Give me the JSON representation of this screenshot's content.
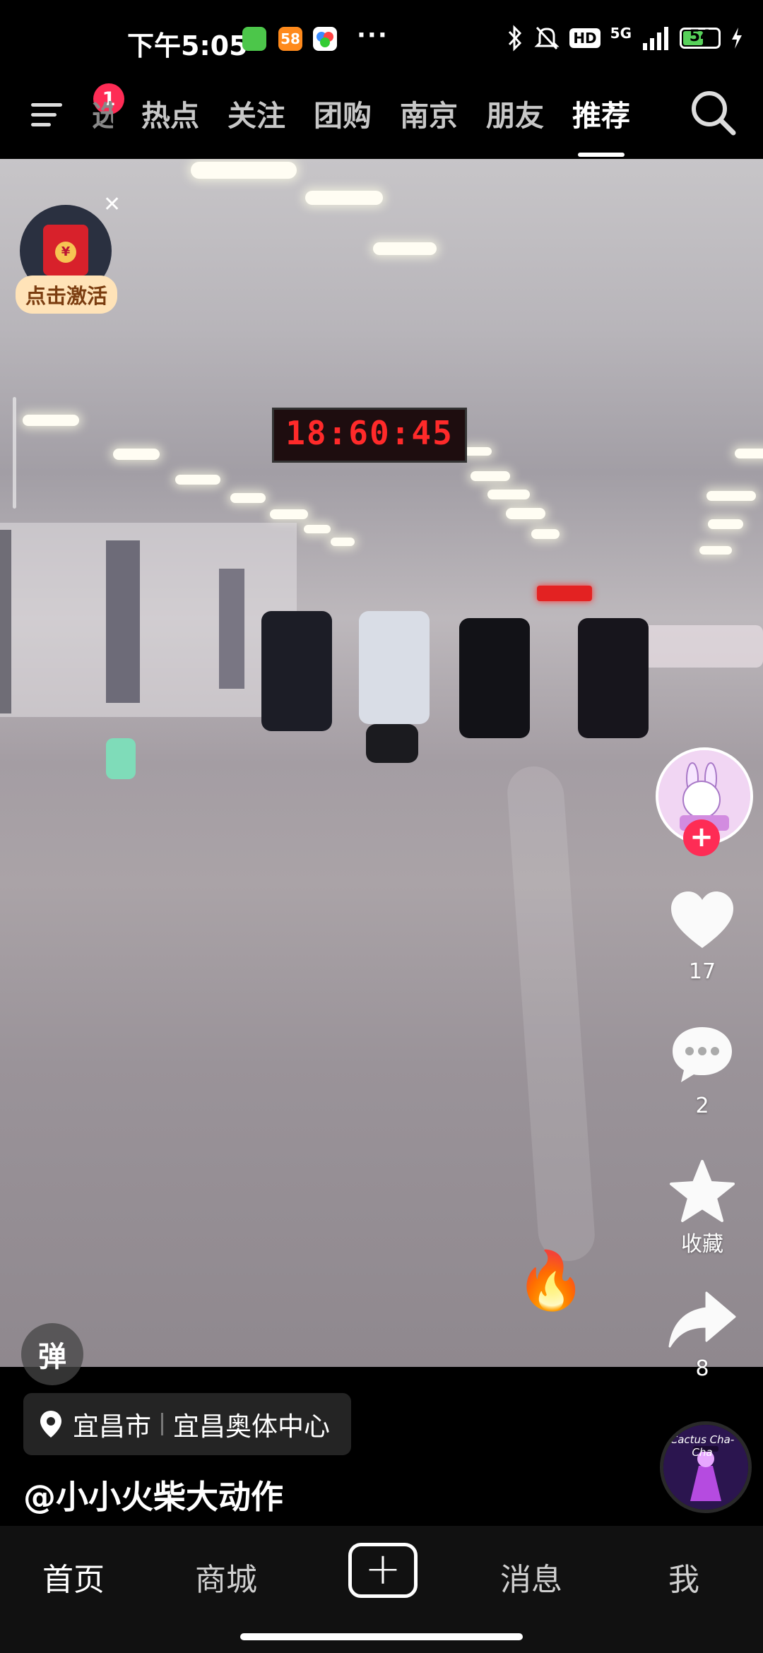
{
  "status_bar": {
    "time": "下午5:05",
    "network": "5G",
    "hd": "HD",
    "battery": "54",
    "more": "···",
    "app_icon_58": "58"
  },
  "top_nav": {
    "notification_badge": "1",
    "tabs": [
      {
        "label": "选",
        "partial": true
      },
      {
        "label": "热点"
      },
      {
        "label": "关注"
      },
      {
        "label": "团购"
      },
      {
        "label": "南京"
      },
      {
        "label": "朋友"
      },
      {
        "label": "推荐",
        "active": true
      }
    ]
  },
  "video": {
    "scoreboard_text": "18:60:45"
  },
  "red_packet": {
    "label": "点击激活",
    "coin": "¥"
  },
  "right_rail": {
    "like_count": "17",
    "comment_count": "2",
    "favorite_label": "收藏",
    "share_count": "8",
    "fire_emoji": "🔥"
  },
  "danmaku": {
    "label": "弹"
  },
  "location": {
    "city": "宜昌市",
    "place": "宜昌奥体中心"
  },
  "author": {
    "handle": "@小小火柴大动作"
  },
  "music_disc": {
    "text": "Cactus Cha-Cha"
  },
  "bottom_nav": {
    "home": "首页",
    "mall": "商城",
    "add": "+",
    "messages": "消息",
    "me": "我"
  },
  "colors": {
    "accent": "#fe2c55",
    "battery": "#57d15a",
    "nav_bg": "#111111"
  }
}
